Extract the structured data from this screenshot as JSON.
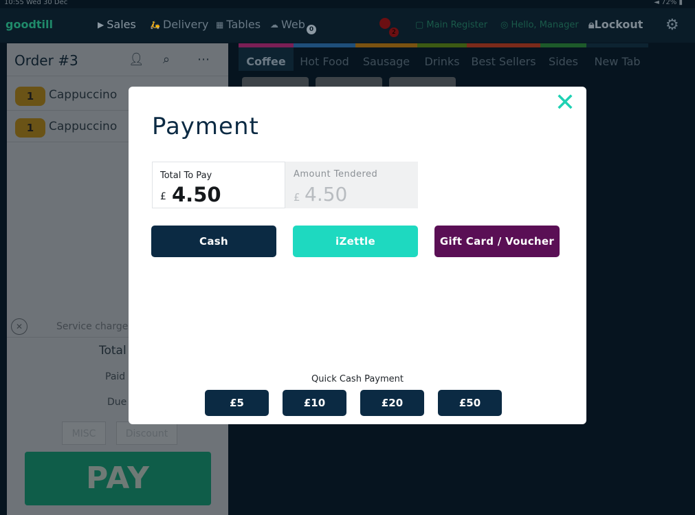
{
  "status_bar": {
    "time": "10:55  Wed 30 Dec",
    "battery": "◄ 72% ▮"
  },
  "app": {
    "brand": "goodtill",
    "nav": {
      "sales": "Sales",
      "delivery": "Delivery",
      "tables": "Tables",
      "web": "Web",
      "web_badge": "0",
      "alerts_badge": "2",
      "register": "Main Register",
      "greeting": "Hello, Manager",
      "lockout": "Lockout"
    },
    "icons": {
      "sales": "play-icon",
      "delivery": "scooter-icon",
      "tables": "table-grid-icon",
      "web": "cloud-icon",
      "register": "register-icon",
      "user": "user-circle-icon",
      "lock": "lock-icon",
      "settings": "gear-icon"
    }
  },
  "order": {
    "title": "Order #3",
    "items": [
      {
        "qty": "1",
        "name": "Cappuccino"
      },
      {
        "qty": "1",
        "name": "Cappuccino"
      }
    ],
    "service_charge_label": "Service charge",
    "total_label": "Total",
    "paid_label": "Paid",
    "due_label": "Due",
    "misc_label": "MISC",
    "discount_label": "Discount",
    "pay_label": "PAY"
  },
  "category_tabs": [
    {
      "label": "Coffee",
      "color": "#7a1f55",
      "active": true
    },
    {
      "label": "Hot Food",
      "color": "#1f4f7a"
    },
    {
      "label": "Sausage",
      "color": "#7a5211"
    },
    {
      "label": "Drinks",
      "color": "#3c5a13"
    },
    {
      "label": "Best Sellers",
      "color": "#7a2a1a"
    },
    {
      "label": "Sides",
      "color": "#1d5a2a"
    },
    {
      "label": "New Tab",
      "color": "#0d2331"
    }
  ],
  "payment_modal": {
    "title": "Payment",
    "total_to_pay_label": "Total To Pay",
    "currency": "£",
    "total_to_pay": "4.50",
    "amount_tendered_label": "Amount Tendered",
    "amount_tendered": "4.50",
    "methods": {
      "cash": "Cash",
      "izettle": "iZettle",
      "gift": "Gift Card / Voucher"
    },
    "method_colors": {
      "cash": "#0b2a43",
      "izettle": "#1ed9c0",
      "gift": "#5a0f55"
    },
    "quick_cash_label": "Quick Cash Payment",
    "quick_cash": [
      "£5",
      "£10",
      "£20",
      "£50"
    ],
    "close_icon": "close-icon"
  }
}
